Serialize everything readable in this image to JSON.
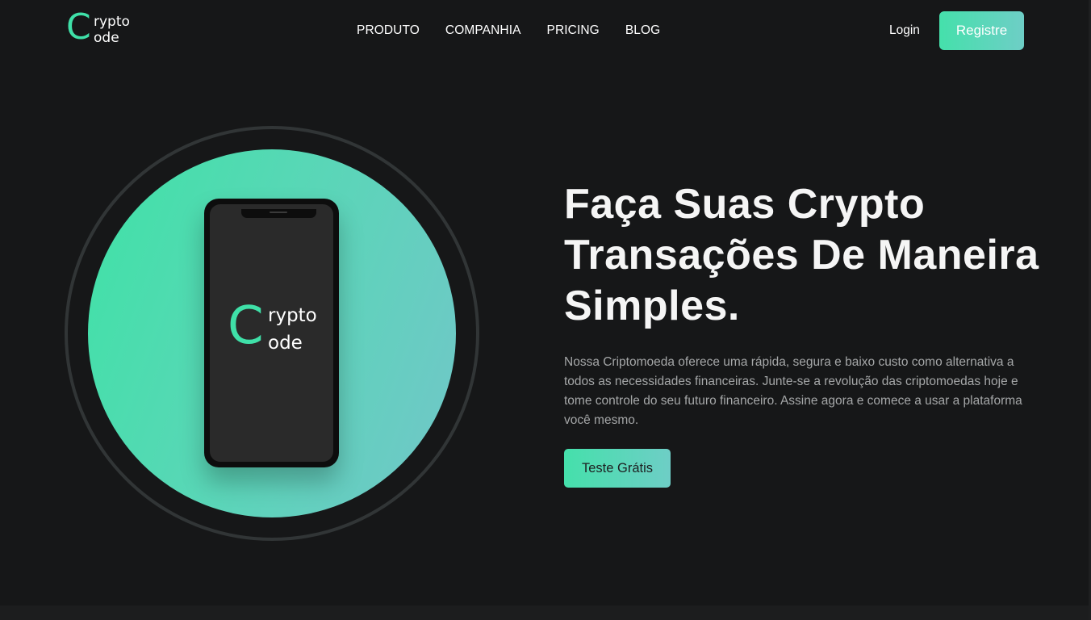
{
  "brand": {
    "logo_c": "C",
    "logo_line1": "rypto",
    "logo_line2": "ode",
    "accent": "#3fe0a8",
    "accent_end": "#72c6c9",
    "background": "#161718"
  },
  "nav": {
    "items": [
      "PRODUTO",
      "COMPANHIA",
      "PRICING",
      "BLOG"
    ]
  },
  "auth": {
    "login_label": "Login",
    "register_label": "Registre"
  },
  "hero": {
    "phone_logo_c": "C",
    "phone_logo_line1": "rypto",
    "phone_logo_line2": "ode",
    "headline": "Faça Suas Crypto Transações De Maneira Simples.",
    "description": "Nossa Criptomoeda oferece uma rápida, segura e baixo custo como alternativa a todos as necessidades financeiras. Junte-se a revolução das criptomoedas hoje e tome controle do seu futuro financeiro. Assine agora e comece a usar a plataforma você mesmo.",
    "cta_label": "Teste Grátis"
  }
}
